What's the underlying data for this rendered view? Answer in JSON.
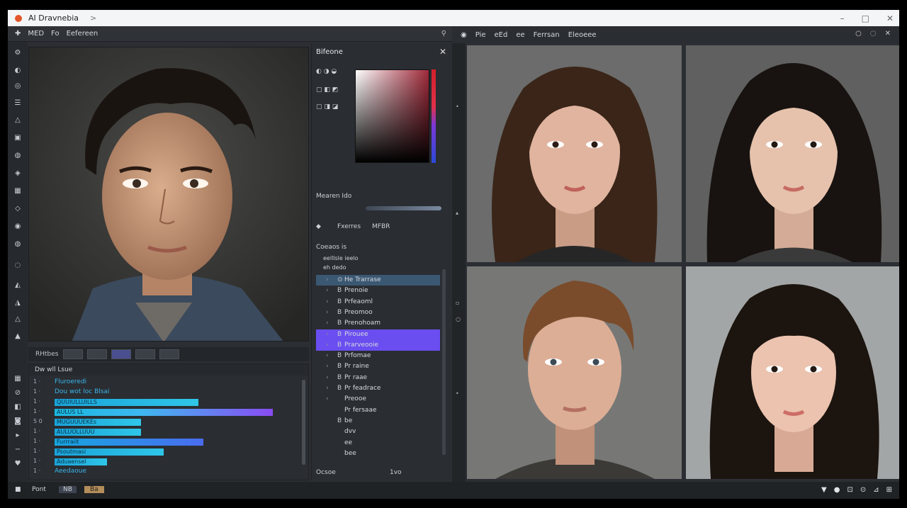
{
  "window": {
    "title": "AI Dravnebia",
    "chevron": ">",
    "minimize": "–",
    "maximize": "□",
    "close": "✕"
  },
  "left_toolbar": {
    "items": [
      "✚",
      "MED",
      "Fo",
      "Eefereen"
    ],
    "right_icon": "⚲"
  },
  "left_icons": [
    "⚙",
    "◐",
    "◎",
    "☰",
    "△",
    "▣",
    "◍",
    "◈",
    "▦",
    "◇",
    "◉",
    "◍",
    "◌",
    "◭",
    "◮",
    "△",
    "▲"
  ],
  "thumb_strip": {
    "label": "RHtbes"
  },
  "bars_panel": {
    "header": "Dw wll Lsue",
    "rows": [
      {
        "num": "1 ·",
        "text": "Fluroeredi",
        "style": "label"
      },
      {
        "num": "1 ·",
        "text": "Dou wot loc Blsai",
        "style": "label"
      },
      {
        "num": "1 ·",
        "text": "QUUIULLUILLS",
        "style": "bar",
        "fill": 0.58
      },
      {
        "num": "1 ·",
        "text": "AULUS LL",
        "style": "violet",
        "fill": 0.88
      },
      {
        "num": "5 0",
        "text": "MUGUUUEKEs",
        "style": "bar",
        "fill": 0.35
      },
      {
        "num": "1 ·",
        "text": "AULUOLLUUU",
        "style": "bar",
        "fill": 0.35
      },
      {
        "num": "1 ·",
        "text": "Furrraiit",
        "style": "blue",
        "fill": 0.6
      },
      {
        "num": "1 ·",
        "text": "Psoutmasi",
        "style": "bar",
        "fill": 0.44
      },
      {
        "num": "1 ·",
        "text": "Aduaensel",
        "style": "bar",
        "fill": 0.21
      },
      {
        "num": "1 ·",
        "text": "Aeedaoue",
        "style": "label"
      }
    ]
  },
  "middle_panel": {
    "title": "Bifeone",
    "close": "✕",
    "section_label": "Mearen Ido",
    "layer_row": {
      "icon": "◆",
      "a": "Fxerres",
      "b": "MFBR"
    },
    "tree_title": "Coeaos is",
    "tree_sub1": "eelllsle ieelo",
    "tree_sub2": "eh dedo",
    "tree_nodes": [
      {
        "label": "He Trarrase",
        "state": "hl",
        "icon": "⊙"
      },
      {
        "label": "Prenoie",
        "state": "",
        "icon": "B"
      },
      {
        "label": "Prfeaoml",
        "state": "",
        "icon": "B"
      },
      {
        "label": "Preomoo",
        "state": "",
        "icon": "B"
      },
      {
        "label": "Prenohoam",
        "state": "",
        "icon": "B"
      },
      {
        "label": "Pirouee",
        "state": "sel",
        "icon": "B"
      },
      {
        "label": "Prarveooie",
        "state": "sel",
        "icon": "B"
      },
      {
        "label": "Prfomae",
        "state": "",
        "icon": "B"
      },
      {
        "label": "Pr raine",
        "state": "",
        "icon": "B"
      },
      {
        "label": "Pr raae",
        "state": "",
        "icon": "B"
      },
      {
        "label": "Pr feadrace",
        "state": "",
        "icon": "B"
      },
      {
        "label": "Preooe",
        "state": "",
        "icon": ""
      },
      {
        "label": "Pr fersaae",
        "state": "",
        "icon": ""
      },
      {
        "label": "be",
        "state": "",
        "icon": "B"
      },
      {
        "label": "dvv",
        "state": "",
        "icon": ""
      },
      {
        "label": "ee",
        "state": "",
        "icon": ""
      },
      {
        "label": "bee",
        "state": "",
        "icon": ""
      }
    ],
    "footer_left": "Ocsoe",
    "footer_right": "1vo"
  },
  "right_toolbar": {
    "items": [
      "Pie",
      "eEd",
      "ee",
      "Ferrsan",
      "Eleoeee"
    ],
    "icons": [
      "○",
      "◌",
      "✕"
    ]
  },
  "status": {
    "left_label": "Pont",
    "tab1": "NB",
    "tab2": "Ba",
    "right_icons": [
      "▼",
      "●",
      "⊡",
      "⊙",
      "⊿",
      "⊞"
    ]
  },
  "colors": {
    "accent_violet": "#6a4ef0",
    "accent_cyan": "#1aa3d9",
    "panel": "#2a2d32"
  },
  "photos": [
    {
      "subject": "young-man-dark-hair"
    },
    {
      "subject": "woman-long-hair-1"
    },
    {
      "subject": "woman-long-hair-2"
    },
    {
      "subject": "young-man-brown-hair"
    },
    {
      "subject": "woman-bangs"
    }
  ]
}
